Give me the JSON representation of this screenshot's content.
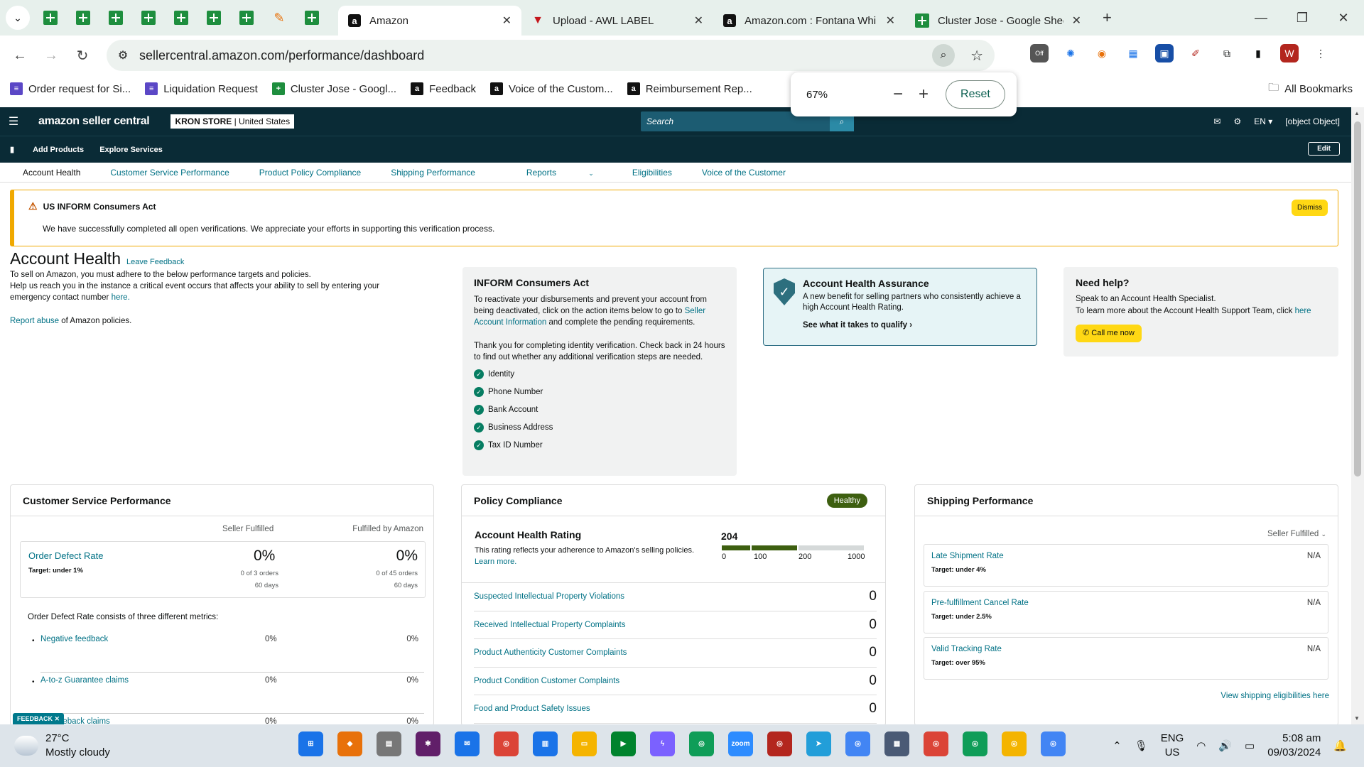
{
  "browser": {
    "tabs": [
      {
        "title": "Amazon",
        "icon": "amazon-icon",
        "active": true
      },
      {
        "title": "Upload - AWL LABEL",
        "icon": "awl-icon"
      },
      {
        "title": "Amazon.com : Fontana Whi",
        "icon": "amazon-icon"
      },
      {
        "title": "Cluster Jose - Google Shee",
        "icon": "sheets-icon"
      }
    ],
    "url": "sellercentral.amazon.com/performance/dashboard",
    "zoom": {
      "value": "67%",
      "reset_label": "Reset"
    },
    "avatar_letter": "W",
    "bookmarks": [
      {
        "label": "Order request for Si...",
        "icon": "forms-icon"
      },
      {
        "label": "Liquidation Request",
        "icon": "forms-icon"
      },
      {
        "label": "Cluster Jose - Googl...",
        "icon": "sheets-icon"
      },
      {
        "label": "Feedback",
        "icon": "amazon-icon"
      },
      {
        "label": "Voice of the Custom...",
        "icon": "amazon-icon"
      },
      {
        "label": "Reimbursement Rep...",
        "icon": "amazon-icon"
      }
    ],
    "all_bookmarks": "All Bookmarks"
  },
  "sc": {
    "logo": "amazon seller central",
    "store_name": "KRON STORE",
    "store_region": "United States",
    "search_placeholder": "Search",
    "lang": "EN",
    "help": {
      "title": "Need help?",
      "line1": "Speak to an Account Health Specialist.",
      "line2": "To learn more about the Account Health Support Team, click",
      "here": "here",
      "call": "Call me now"
    },
    "sub_nav": [
      "Add Products",
      "Explore Services"
    ],
    "edit": "Edit",
    "nav": [
      "Account Health",
      "Customer Service Performance",
      "Product Policy Compliance",
      "Shipping Performance",
      "Reports",
      "Eligibilities",
      "Voice of the Customer"
    ],
    "alert": {
      "title": "US INFORM Consumers Act",
      "message": "We have successfully completed all open verifications. We appreciate your efforts in supporting this verification process.",
      "dismiss": "Dismiss"
    },
    "account_health": {
      "title": "Account Health",
      "leave_feedback": "Leave Feedback",
      "line1": "To sell on Amazon, you must adhere to the below performance targets and policies.",
      "line2": "Help us reach you in the instance a critical event occurs that affects your ability to sell by entering your emergency contact number",
      "here": "here.",
      "report_abuse": "Report abuse",
      "report_suffix": " of Amazon policies."
    },
    "inform": {
      "title": "INFORM Consumers Act",
      "p1": "To reactivate your disbursements and prevent your account from being deactivated, click on the action items below to go to",
      "p1_link": "Seller Account Information",
      "p1_end": "and complete the pending requirements.",
      "p2": "Thank you for completing identity verification. Check back in 24 hours to find out whether any additional verification steps are needed.",
      "checks": [
        "Identity",
        "Phone Number",
        "Bank Account",
        "Business Address",
        "Tax ID Number"
      ]
    },
    "aha": {
      "title": "Account Health Assurance",
      "text": "A new benefit for selling partners who consistently achieve a high Account Health Rating.",
      "link": "See what it takes to qualify"
    },
    "csp": {
      "title": "Customer Service Performance",
      "col1": "Seller Fulfilled",
      "col2": "Fulfilled by Amazon",
      "odr_name": "Order Defect Rate",
      "odr_target": "Target: under 1%",
      "sf_pct": "0%",
      "sf_orders": "0 of 3 orders",
      "sf_days": "60 days",
      "fba_pct": "0%",
      "fba_orders": "0 of 45 orders",
      "fba_days": "60 days",
      "consists": "Order Defect Rate consists of three different metrics:",
      "metrics": [
        {
          "name": "Negative feedback",
          "sf": "0%",
          "fba": "0%"
        },
        {
          "name": "A-to-z Guarantee claims",
          "sf": "0%",
          "fba": "0%"
        },
        {
          "name": "Chargeback claims",
          "sf": "0%",
          "fba": "0%"
        }
      ]
    },
    "pc": {
      "title": "Policy Compliance",
      "status": "Healthy",
      "ahr_title": "Account Health Rating",
      "ahr_text": "This rating reflects your adherence to Amazon's selling policies.",
      "learn_more": "Learn more.",
      "score": "204",
      "score_fraction": 0.53,
      "ticks": [
        "0",
        "100",
        "200",
        "1000"
      ],
      "rows": [
        {
          "label": "Suspected Intellectual Property Violations",
          "count": "0"
        },
        {
          "label": "Received Intellectual Property Complaints",
          "count": "0"
        },
        {
          "label": "Product Authenticity Customer Complaints",
          "count": "0"
        },
        {
          "label": "Product Condition Customer Complaints",
          "count": "0"
        },
        {
          "label": "Food and Product Safety Issues",
          "count": "0"
        }
      ]
    },
    "shipping": {
      "title": "Shipping Performance",
      "dropdown": "Seller Fulfilled",
      "rows": [
        {
          "name": "Late Shipment Rate",
          "target": "Target: under 4%",
          "value": "N/A"
        },
        {
          "name": "Pre-fulfillment Cancel Rate",
          "target": "Target: under 2.5%",
          "value": "N/A"
        },
        {
          "name": "Valid Tracking Rate",
          "target": "Target: over 95%",
          "value": "N/A"
        }
      ],
      "view_link": "View shipping eligibilities here"
    },
    "feedback_tab": "FEEDBACK"
  },
  "taskbar": {
    "temp": "27°C",
    "weather": "Mostly cloudy",
    "lang1": "ENG",
    "lang2": "US",
    "time": "5:08 am",
    "date": "09/03/2024"
  }
}
